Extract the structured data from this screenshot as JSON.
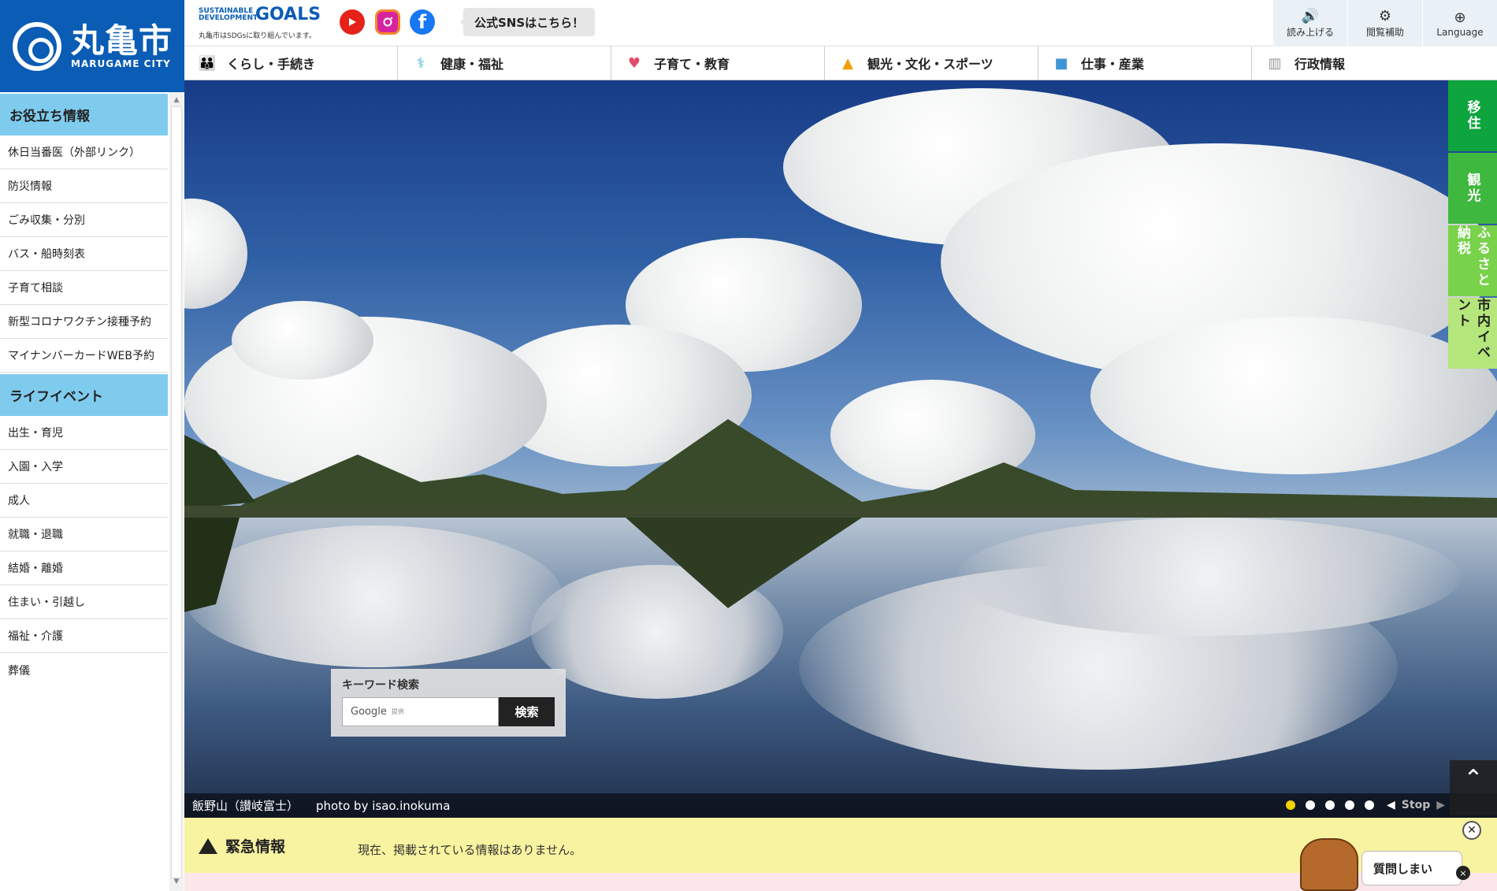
{
  "site": {
    "logo_ja": "丸亀市",
    "logo_en": "MARUGAME CITY"
  },
  "sdgs": {
    "small": "SUSTAINABLE DEVELOPMENT",
    "goals": "GOALS",
    "sub": "丸亀市はSDGsに取り組んでいます。"
  },
  "sns": {
    "youtube_icon": "youtube-icon",
    "instagram_icon": "instagram-icon",
    "facebook_icon": "facebook-icon",
    "button": "公式SNSはこちら！"
  },
  "tools": [
    {
      "label": "読み上げる",
      "icon": "speaker-icon"
    },
    {
      "label": "閲覧補助",
      "icon": "gear-icon"
    },
    {
      "label": "Language",
      "icon": "globe-icon"
    }
  ],
  "gnav": [
    {
      "label": "くらし・手続き",
      "icon": "people-icon",
      "color": "#35b03a"
    },
    {
      "label": "健康・福祉",
      "icon": "stethoscope-icon",
      "color": "#39b6d8"
    },
    {
      "label": "子育て・教育",
      "icon": "family-icon",
      "color": "#e24d6d"
    },
    {
      "label": "観光・文化・スポーツ",
      "icon": "castle-icon",
      "color": "#f0a000"
    },
    {
      "label": "仕事・産業",
      "icon": "briefcase-icon",
      "color": "#3f95d6"
    },
    {
      "label": "行政情報",
      "icon": "building-icon",
      "color": "#999999"
    }
  ],
  "sidebar": {
    "useful_title": "お役立ち情報",
    "useful": [
      "休日当番医（外部リンク）",
      "防災情報",
      "ごみ収集・分別",
      "バス・船時刻表",
      "子育て相談",
      "新型コロナワクチン接種予約",
      "マイナンバーカードWEB予約"
    ],
    "life_title": "ライフイベント",
    "life": [
      "出生・育児",
      "入園・入学",
      "成人",
      "就職・退職",
      "結婚・離婚",
      "住まい・引越し",
      "福祉・介護",
      "葬儀"
    ]
  },
  "hero": {
    "caption": "飯野山（讃岐富士）",
    "photo_credit": "photo by isao.inokuma",
    "active_slide": 1,
    "slide_count": 5,
    "prev": "◀",
    "stop": "Stop",
    "next": "▶"
  },
  "search": {
    "label": "キーワード検索",
    "placeholder": "Google",
    "provided": "提供",
    "button": "検索"
  },
  "side_tabs": [
    "移住",
    "観光",
    "ふるさと納税",
    "市内イベント"
  ],
  "alert": {
    "title": "緊急情報",
    "text": "現在、掲載されている情報はありません。"
  },
  "chat": {
    "label": "質問しまい",
    "close": "×"
  },
  "pagetop": {
    "icon": "chevron-up-icon"
  }
}
